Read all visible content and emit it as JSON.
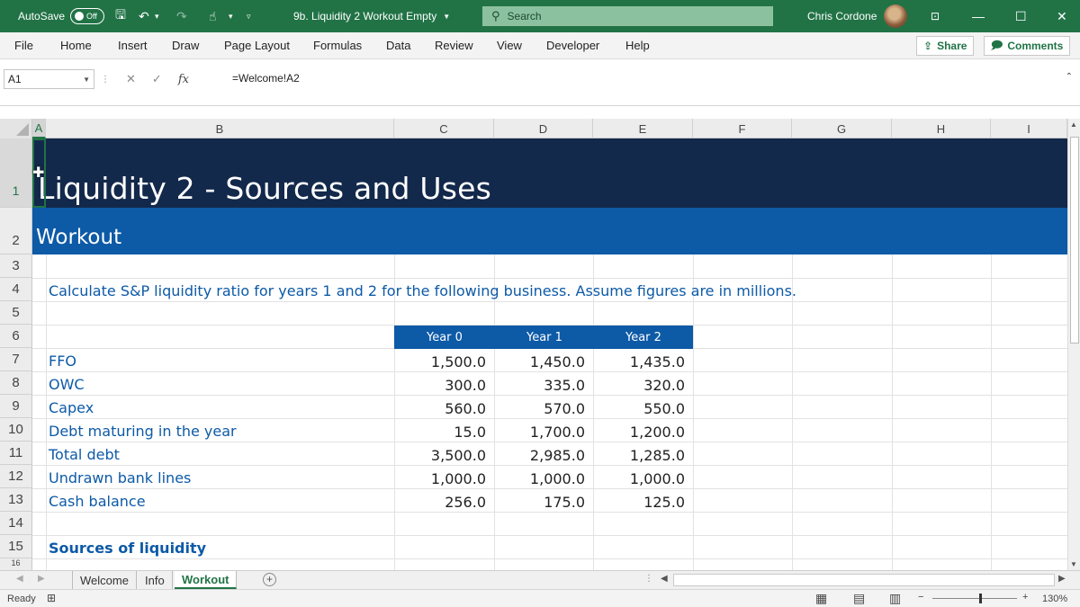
{
  "titlebar": {
    "autosave_label": "AutoSave",
    "autosave_state": "Off",
    "doc_title": "9b. Liquidity 2 Workout Empty",
    "search_placeholder": "Search",
    "user_name": "Chris Cordone"
  },
  "menu": {
    "items": [
      "File",
      "Home",
      "Insert",
      "Draw",
      "Page Layout",
      "Formulas",
      "Data",
      "Review",
      "View",
      "Developer",
      "Help"
    ],
    "share_label": "Share",
    "comments_label": "Comments"
  },
  "formula_bar": {
    "name_box": "A1",
    "fx": "fx",
    "formula": "=Welcome!A2"
  },
  "columns": [
    "A",
    "B",
    "C",
    "D",
    "E",
    "F",
    "G",
    "H",
    "I"
  ],
  "rows": [
    "1",
    "2",
    "3",
    "4",
    "5",
    "6",
    "7",
    "8",
    "9",
    "10",
    "11",
    "12",
    "13",
    "14",
    "15",
    "16"
  ],
  "sheet": {
    "title": "Liquidity 2 - Sources and Uses",
    "subtitle": "Workout",
    "instruction": "Calculate S&P liquidity ratio for years 1 and 2 for the following business. Assume figures are in millions.",
    "year_headers": [
      "Year 0",
      "Year 1",
      "Year 2"
    ],
    "table": [
      {
        "label": "FFO",
        "values": [
          "1,500.0",
          "1,450.0",
          "1,435.0"
        ]
      },
      {
        "label": "OWC",
        "values": [
          "300.0",
          "335.0",
          "320.0"
        ]
      },
      {
        "label": "Capex",
        "values": [
          "560.0",
          "570.0",
          "550.0"
        ]
      },
      {
        "label": "Debt maturing in the year",
        "values": [
          "15.0",
          "1,700.0",
          "1,200.0"
        ]
      },
      {
        "label": "Total debt",
        "values": [
          "3,500.0",
          "2,985.0",
          "1,285.0"
        ]
      },
      {
        "label": "Undrawn bank lines",
        "values": [
          "1,000.0",
          "1,000.0",
          "1,000.0"
        ]
      },
      {
        "label": "Cash balance",
        "values": [
          "256.0",
          "175.0",
          "125.0"
        ]
      }
    ],
    "section_heading": "Sources of liquidity"
  },
  "tabs": {
    "sheets": [
      "Welcome",
      "Info",
      "Workout"
    ],
    "active": "Workout"
  },
  "status": {
    "mode": "Ready",
    "zoom": "130%"
  },
  "colors": {
    "excel_green": "#217346",
    "title_band": "#13294b",
    "subtitle_band": "#0d5aa7",
    "label_blue": "#0d5aa7"
  }
}
